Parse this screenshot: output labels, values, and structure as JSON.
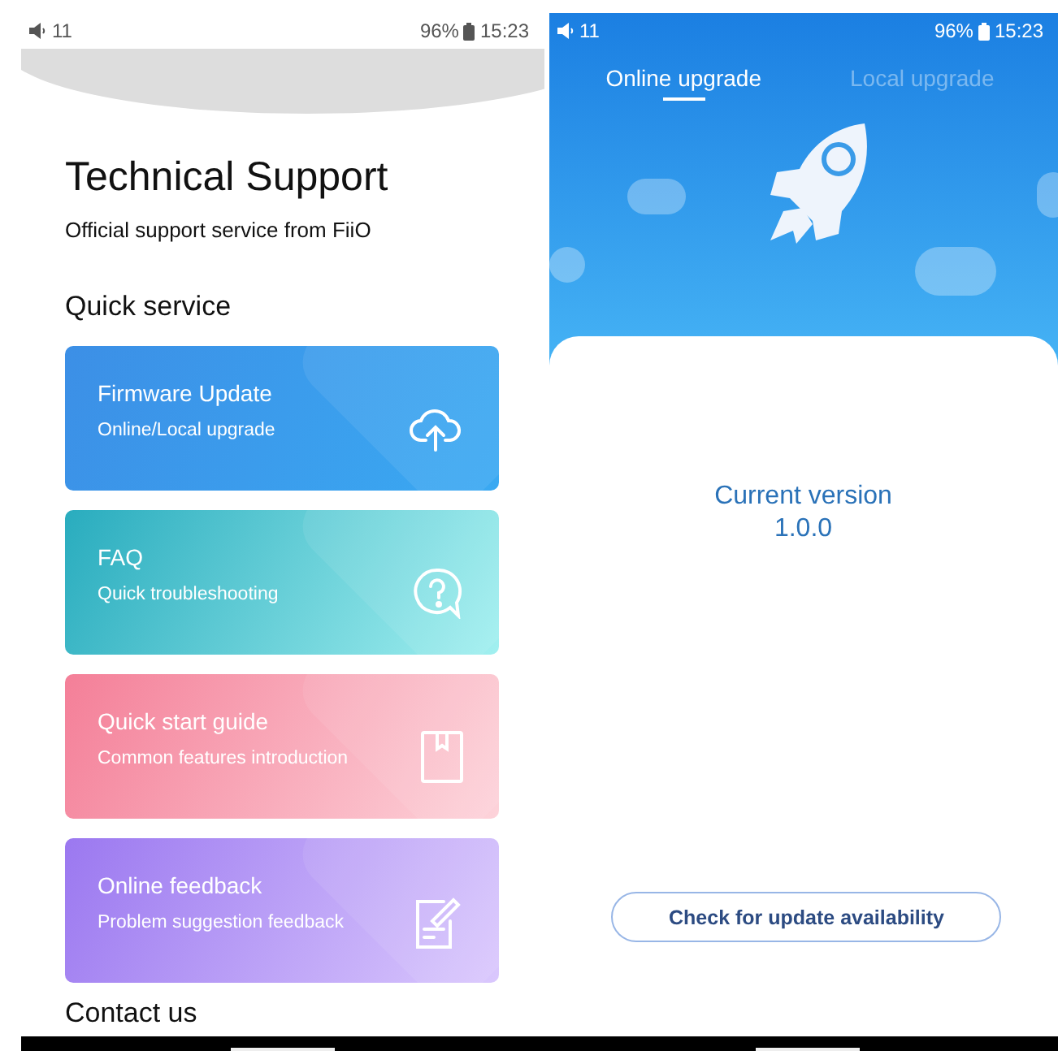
{
  "support_screen": {
    "status_bar": {
      "volume": "11",
      "battery": "96%",
      "time": "15:23"
    },
    "title": "Technical Support",
    "subtitle": "Official support service from FiiO",
    "section": "Quick service",
    "cards": [
      {
        "kind": "upload",
        "title": "Firmware Update",
        "subtitle": "Online/Local upgrade"
      },
      {
        "kind": "help",
        "title": "FAQ",
        "subtitle": "Quick troubleshooting"
      },
      {
        "kind": "guide",
        "title": "Quick start guide",
        "subtitle": "Common features introduction"
      },
      {
        "kind": "feedback",
        "title": "Online feedback",
        "subtitle": "Problem suggestion feedback"
      }
    ],
    "next_section": "Contact us"
  },
  "upgrade_screen": {
    "status_bar": {
      "volume": "11",
      "battery": "96%",
      "time": "15:23"
    },
    "tabs": [
      {
        "label": "Online upgrade",
        "selected": true
      },
      {
        "label": "Local upgrade",
        "selected": false
      }
    ],
    "version_label": "Current version",
    "version": "1.0.0",
    "check_button": "Check for update availability"
  }
}
